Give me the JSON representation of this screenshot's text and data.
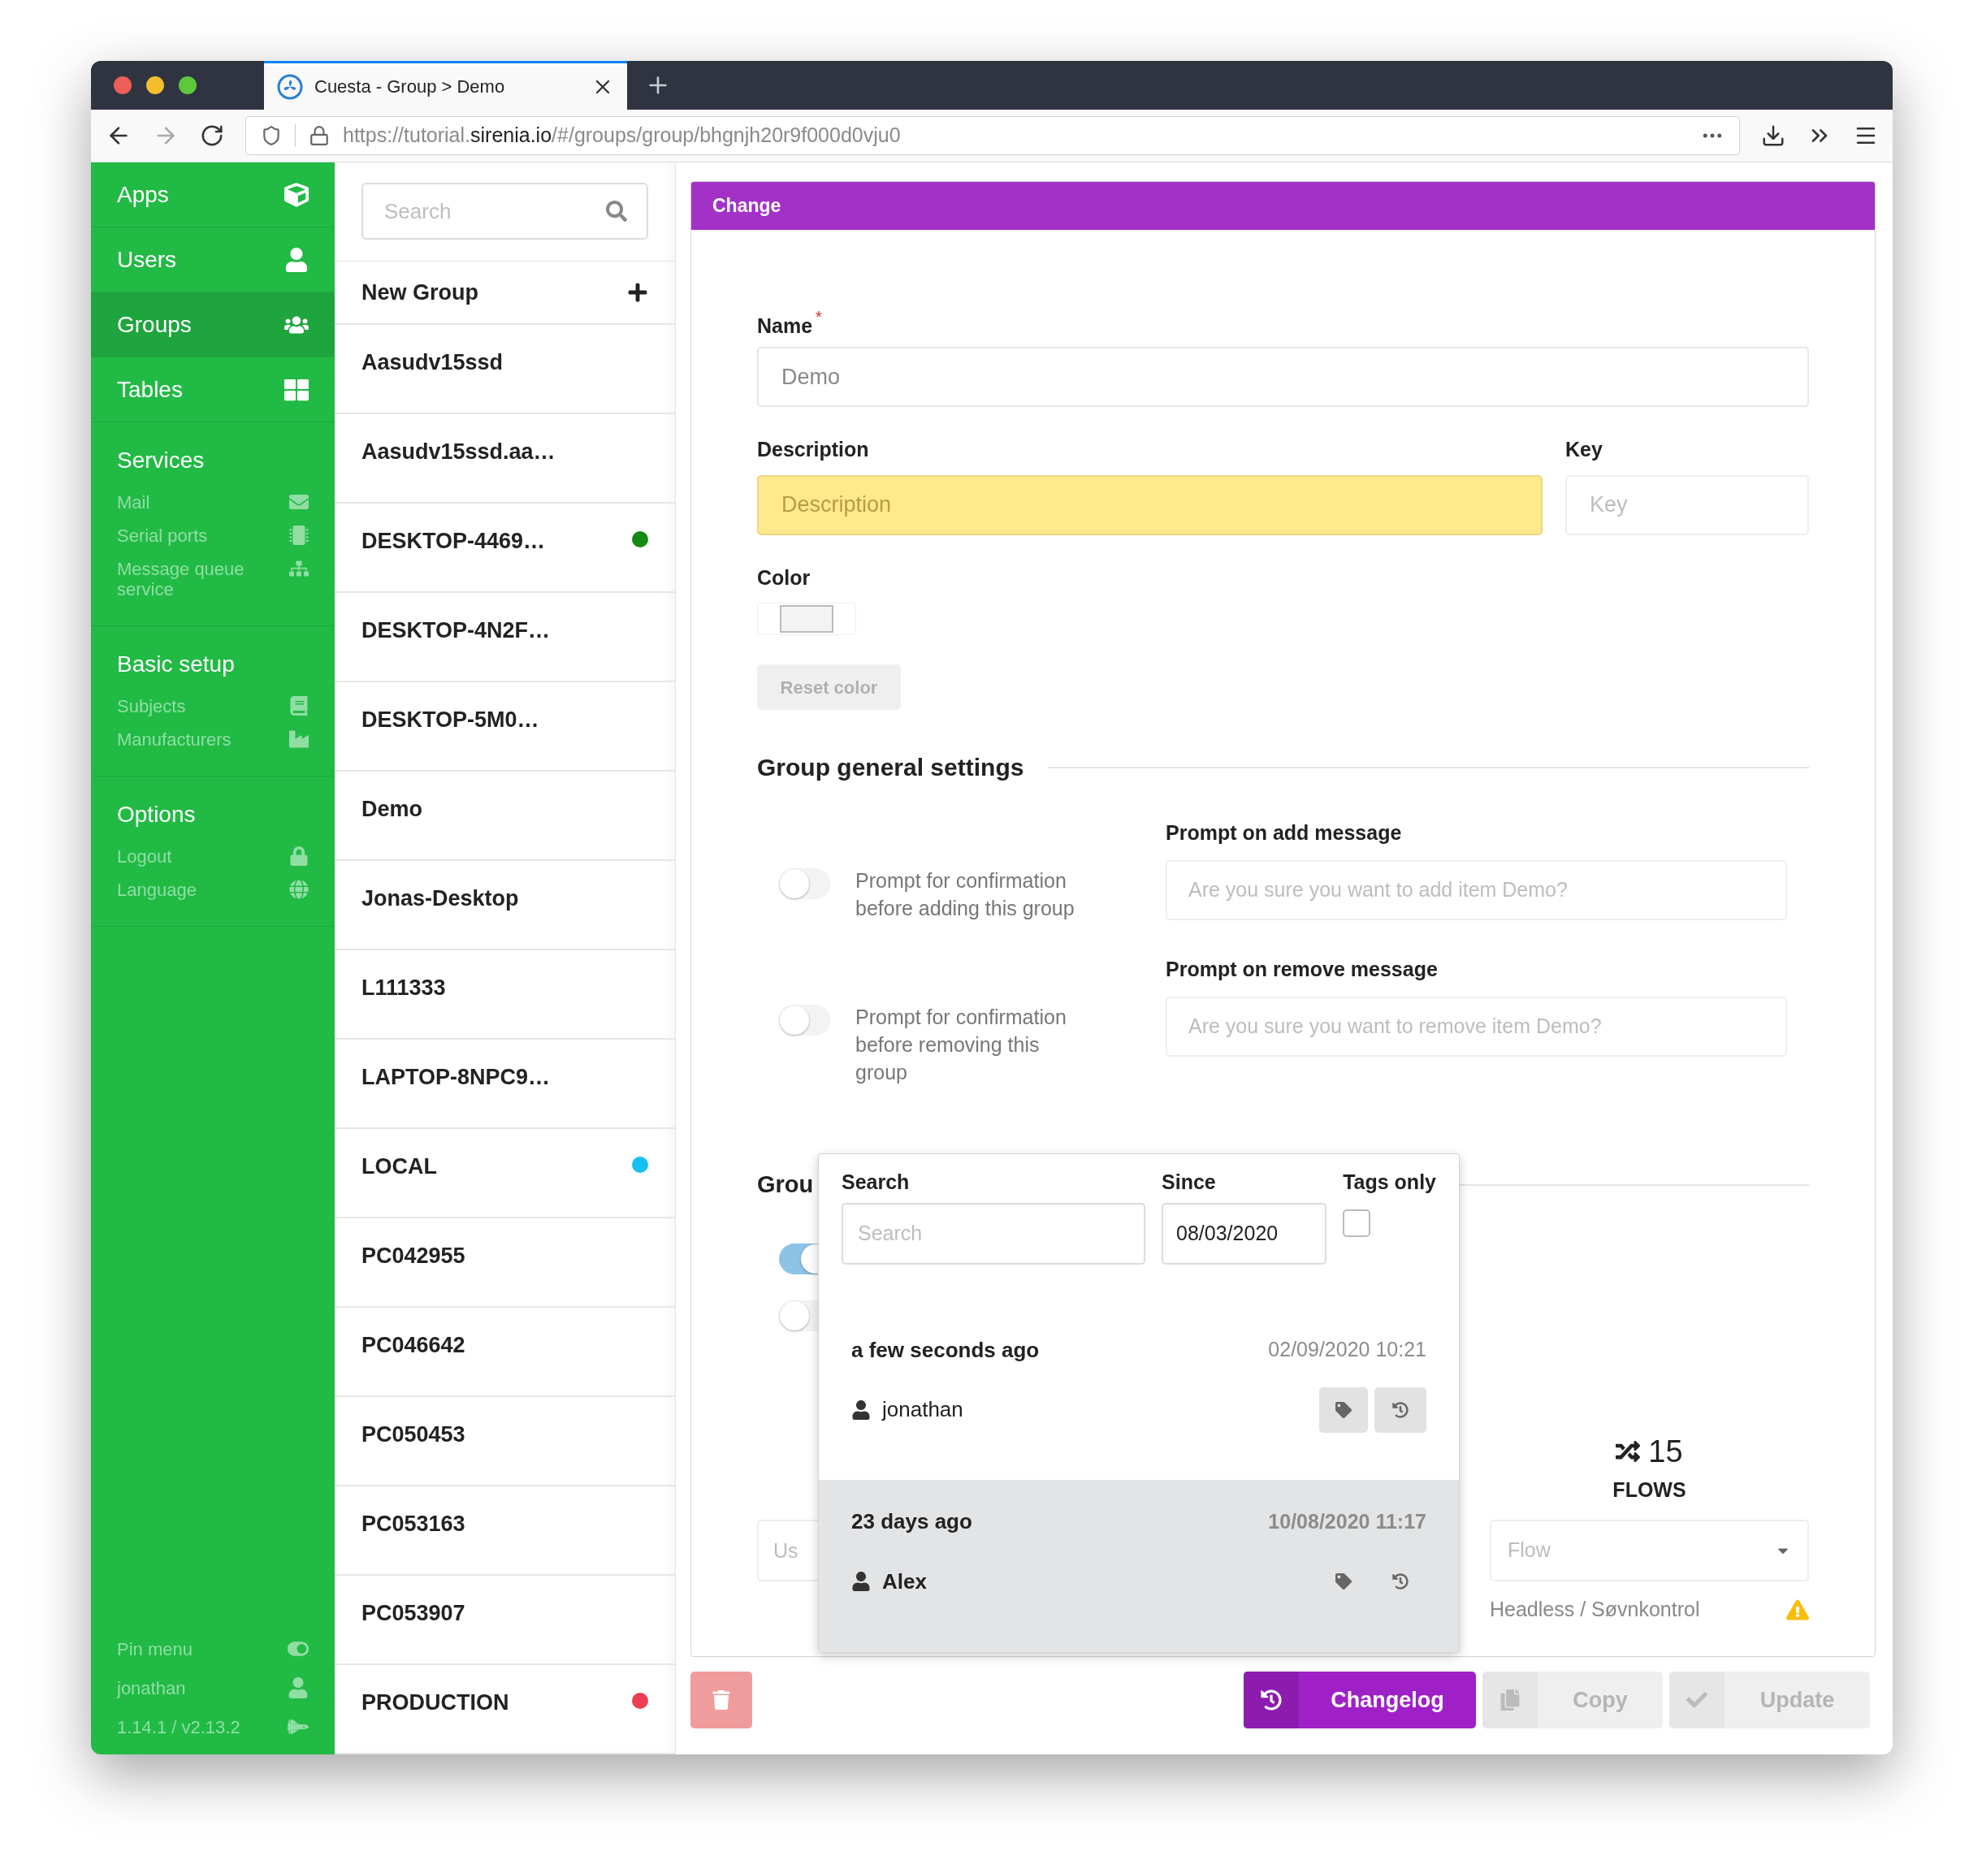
{
  "browser": {
    "tab_title": "Cuesta - Group > Demo",
    "url": {
      "host_start": "https://tutorial.",
      "domain": "sirenia.io",
      "path": "/#/groups/group/bhgnjh20r9f000d0vju0"
    }
  },
  "sidebar": {
    "nav": [
      {
        "label": "Apps",
        "selected": false
      },
      {
        "label": "Users",
        "selected": false
      },
      {
        "label": "Groups",
        "selected": true
      },
      {
        "label": "Tables",
        "selected": false
      }
    ],
    "sections": [
      {
        "title": "Services",
        "items": [
          {
            "label": "Mail"
          },
          {
            "label": "Serial ports"
          },
          {
            "label": "Message queue service"
          }
        ]
      },
      {
        "title": "Basic setup",
        "items": [
          {
            "label": "Subjects"
          },
          {
            "label": "Manufacturers"
          }
        ]
      },
      {
        "title": "Options",
        "items": [
          {
            "label": "Logout"
          },
          {
            "label": "Language"
          }
        ]
      }
    ],
    "footer": [
      {
        "label": "Pin menu"
      },
      {
        "label": "jonathan"
      },
      {
        "label": "1.14.1 / v2.13.2"
      }
    ]
  },
  "groups_list": {
    "search_placeholder": "Search",
    "new_group": "New Group",
    "groups": [
      {
        "name": "Aasudv15ssd"
      },
      {
        "name": "Aasudv15ssd.aa…"
      },
      {
        "name": "DESKTOP-4469…",
        "color": "#138a12"
      },
      {
        "name": "DESKTOP-4N2F…"
      },
      {
        "name": "DESKTOP-5M0…"
      },
      {
        "name": "Demo"
      },
      {
        "name": "Jonas-Desktop"
      },
      {
        "name": "L111333"
      },
      {
        "name": "LAPTOP-8NPC9…"
      },
      {
        "name": "LOCAL",
        "color": "#12c1f2"
      },
      {
        "name": "PC042955"
      },
      {
        "name": "PC046642"
      },
      {
        "name": "PC050453"
      },
      {
        "name": "PC053163"
      },
      {
        "name": "PC053907"
      },
      {
        "name": "PRODUCTION",
        "color": "#ef3e51"
      }
    ]
  },
  "form": {
    "header": "Change",
    "name": {
      "label": "Name",
      "required_mark": "*",
      "value": "Demo"
    },
    "description": {
      "label": "Description",
      "placeholder": "Description"
    },
    "key": {
      "label": "Key",
      "placeholder": "Key"
    },
    "color": {
      "label": "Color"
    },
    "reset_color": "Reset color",
    "general_title": "Group general settings",
    "prompts": [
      {
        "toggle_text": "Prompt for confirmation before adding this group",
        "on": false,
        "field_label": "Prompt on add message",
        "placeholder": "Are you sure you want to add item Demo?"
      },
      {
        "toggle_text": "Prompt for confirmation before removing this group",
        "on": false,
        "field_label": "Prompt on remove message",
        "placeholder": "Are you sure you want to remove item Demo?"
      }
    ],
    "second_title": "Grou",
    "toggles": [
      {
        "on": true
      },
      {
        "on": false
      }
    ],
    "user_field_placeholder": "Us",
    "flows": {
      "count": "15",
      "label": "FLOWS"
    },
    "flow_select_placeholder": "Flow",
    "flow_items": [
      {
        "label": "Headless / Søvnkontrol"
      }
    ]
  },
  "changelog": {
    "search": {
      "label": "Search",
      "placeholder": "Search"
    },
    "since": {
      "label": "Since",
      "value": "08/03/2020"
    },
    "tags_only": {
      "label": "Tags only",
      "checked": false
    },
    "entries": [
      {
        "ago": "a few seconds ago",
        "timestamp": "02/09/2020 10:21",
        "user": "jonathan",
        "selected": false
      },
      {
        "ago": "23 days ago",
        "timestamp": "10/08/2020 11:17",
        "user": "Alex",
        "selected": true
      }
    ]
  },
  "actions": [
    {
      "kind": "delete",
      "disabled": true
    },
    {
      "kind": "changelog",
      "label": "Changelog",
      "disabled": false
    },
    {
      "kind": "copy",
      "label": "Copy",
      "disabled": true
    },
    {
      "kind": "update",
      "label": "Update",
      "disabled": true
    }
  ]
}
